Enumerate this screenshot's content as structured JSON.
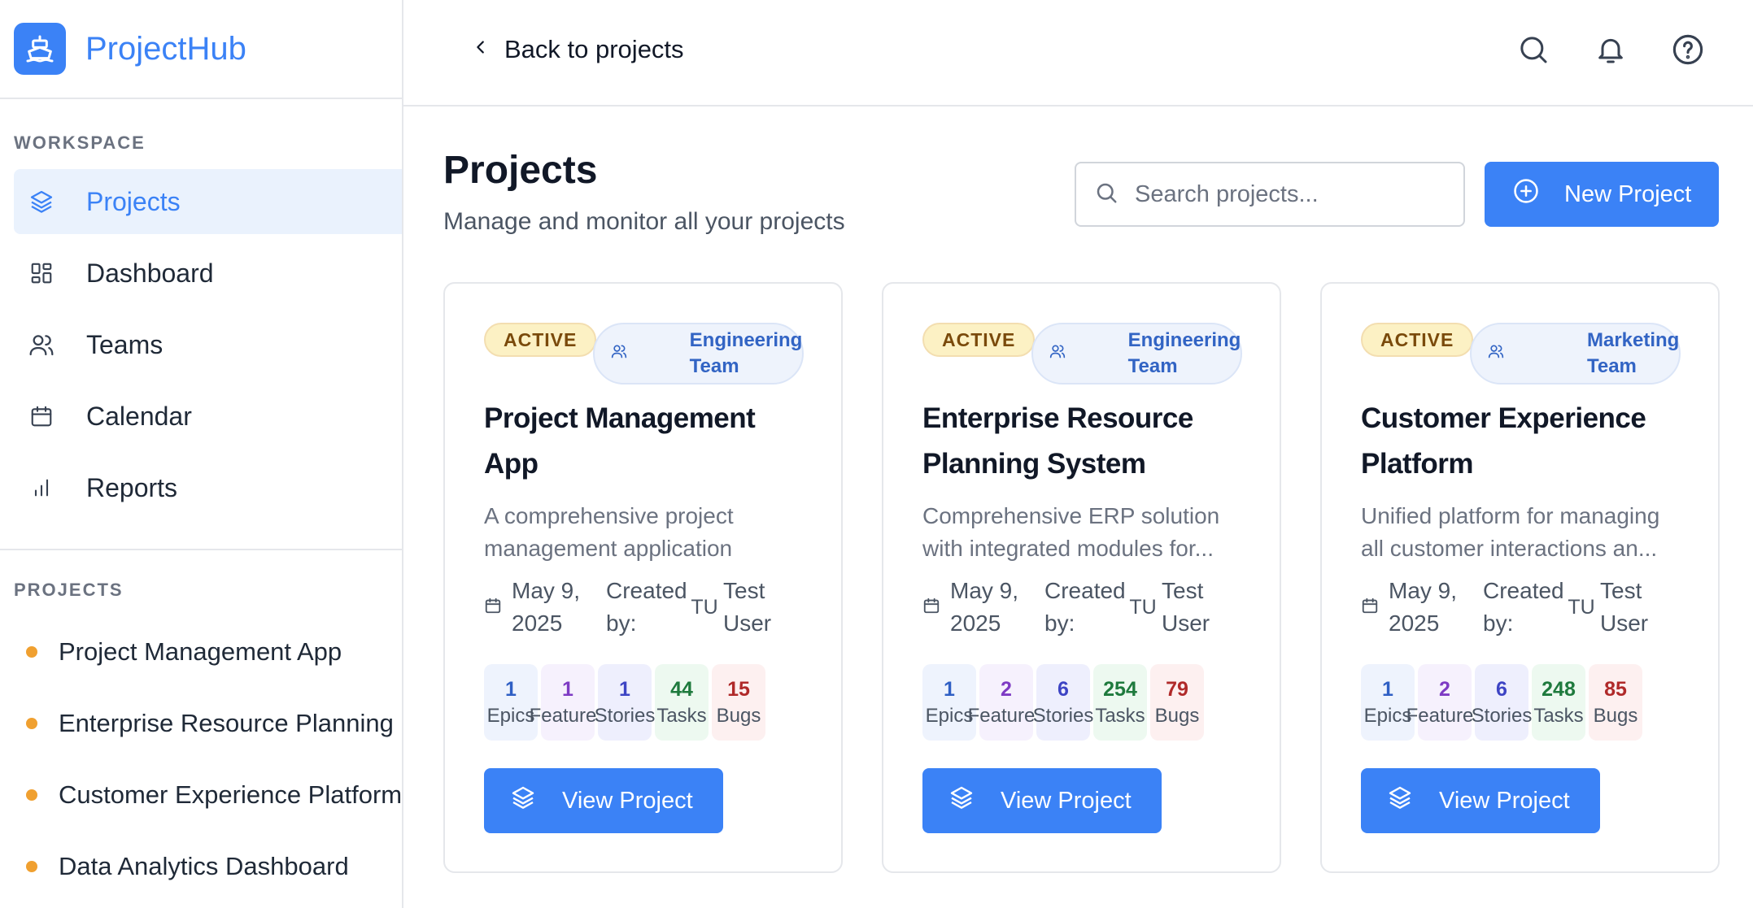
{
  "brand": {
    "name": "ProjectHub",
    "icon": "ship-icon"
  },
  "sidebar": {
    "workspace_title": "WORKSPACE",
    "nav": [
      {
        "label": "Projects",
        "icon": "layers-icon",
        "active": true
      },
      {
        "label": "Dashboard",
        "icon": "grid-icon",
        "active": false
      },
      {
        "label": "Teams",
        "icon": "users-icon",
        "active": false
      },
      {
        "label": "Calendar",
        "icon": "calendar-icon",
        "active": false
      },
      {
        "label": "Reports",
        "icon": "bar-chart-icon",
        "active": false
      }
    ],
    "projects_title": "PROJECTS",
    "projects": [
      "Project Management App",
      "Enterprise Resource Planning",
      "Customer Experience Platform",
      "Data Analytics Dashboard"
    ]
  },
  "header": {
    "back_label": "Back to projects",
    "icons": [
      "search-icon",
      "bell-icon",
      "help-icon"
    ]
  },
  "main": {
    "title": "Projects",
    "subtitle": "Manage and monitor all your projects",
    "search_placeholder": "Search projects...",
    "new_project_label": "New Project",
    "cards": [
      {
        "status": "ACTIVE",
        "team": "Engineering Team",
        "title": "Project Management App",
        "description": "A comprehensive project management application",
        "date": "May 9, 2025",
        "created_by_label": "Created by:",
        "avatar": "TU",
        "user": "Test User",
        "stats": {
          "epics": "1",
          "features": "1",
          "stories": "1",
          "tasks": "44",
          "bugs": "15"
        },
        "view_label": "View Project"
      },
      {
        "status": "ACTIVE",
        "team": "Engineering Team",
        "title": "Enterprise Resource Planning System",
        "description": "Comprehensive ERP solution with integrated modules for...",
        "date": "May 9, 2025",
        "created_by_label": "Created by:",
        "avatar": "TU",
        "user": "Test User",
        "stats": {
          "epics": "1",
          "features": "2",
          "stories": "6",
          "tasks": "254",
          "bugs": "79"
        },
        "view_label": "View Project"
      },
      {
        "status": "ACTIVE",
        "team": "Marketing Team",
        "title": "Customer Experience Platform",
        "description": "Unified platform for managing all customer interactions an...",
        "date": "May 9, 2025",
        "created_by_label": "Created by:",
        "avatar": "TU",
        "user": "Test User",
        "stats": {
          "epics": "1",
          "features": "2",
          "stories": "6",
          "tasks": "248",
          "bugs": "85"
        },
        "view_label": "View Project"
      }
    ],
    "stat_labels": {
      "epics": "Epics",
      "features": "Features",
      "stories": "Stories",
      "tasks": "Tasks",
      "bugs": "Bugs"
    }
  },
  "colors": {
    "accent": "#3b82f6",
    "active_nav_bg": "#eaf2fd",
    "project_dot": "#f0a030"
  }
}
